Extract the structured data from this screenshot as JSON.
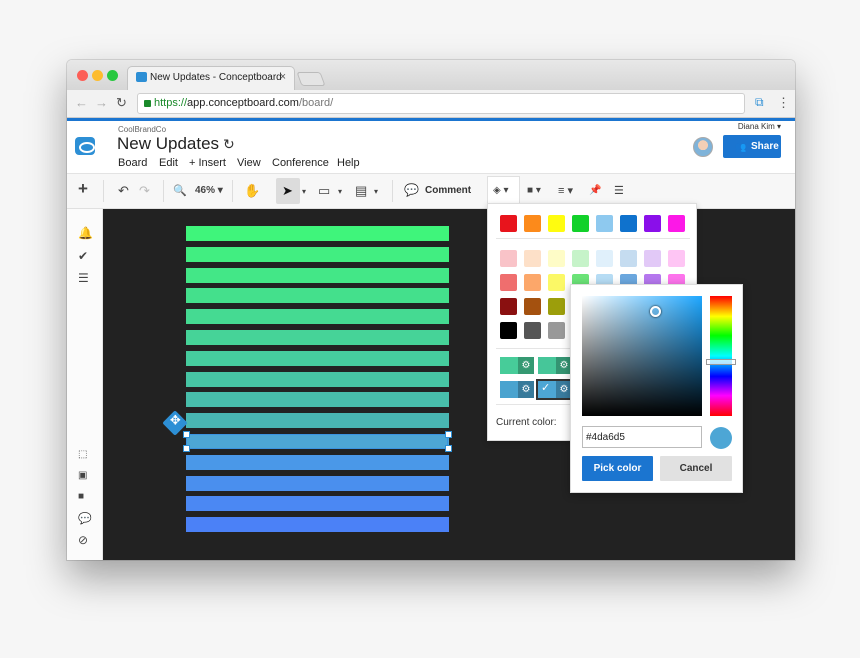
{
  "browser": {
    "tab_title": "New Updates - Conceptboard",
    "tab_close": "×",
    "url_scheme": "https://",
    "url_host": "app.conceptboard.com",
    "url_path": "/board/",
    "back": "←",
    "forward": "→",
    "reload": "↻",
    "more": "⋮"
  },
  "header": {
    "brand": "CoolBrandCo",
    "title": "New Updates",
    "sync_icon": "↻",
    "menu": [
      "Board",
      "Edit",
      "+ Insert",
      "View",
      "Conference",
      "Help"
    ],
    "user_name": "Diana Kim ▾",
    "share_label": "Share",
    "share_icon": "👥"
  },
  "toolbar": {
    "add": "+",
    "undo": "↶",
    "redo": "↷",
    "zoom_icon": "🔍",
    "zoom_value": "46% ▾",
    "hand": "✋",
    "pointer": "➤",
    "pointer_caret": "▾",
    "shape": "▭",
    "shape_caret": "▾",
    "note": "▤",
    "note_caret": "▾",
    "comment_icon": "💬",
    "comment_label": "Comment",
    "fill": "◈ ▾",
    "color": "■ ▾",
    "lines": "≡ ▾",
    "pin": "📌",
    "list": "☰"
  },
  "sidebar": {
    "icons": [
      "🔔",
      "✔",
      "☰",
      "⬚",
      "▣",
      "■",
      "💬",
      "⊘"
    ]
  },
  "canvas": {
    "bars": [
      "#3ff57b",
      "#41ee81",
      "#43e787",
      "#44e08c",
      "#45da92",
      "#46d398",
      "#46cc9e",
      "#47c5a4",
      "#48beab",
      "#49b6b2",
      "#4da6d5",
      "#4a98e8",
      "#4a8fee",
      "#4b88f3",
      "#4b81f7"
    ]
  },
  "palette": {
    "row1": [
      "#e8141c",
      "#fc8a1b",
      "#fffc0f",
      "#12d12a",
      "#8ec9ef",
      "#0f72cd",
      "#8a0fea",
      "#fc18e7"
    ],
    "grid": [
      [
        "#f9c3c8",
        "#fde0c8",
        "#fefcc7",
        "#c6f3c9",
        "#e0f0fb",
        "#c5dcf0",
        "#e2c9f7",
        "#fec5f4"
      ],
      [
        "#ef6e6e",
        "#fca76a",
        "#fbf866",
        "#6be377",
        "#b6dcf4",
        "#6ba7de",
        "#b577ee",
        "#fd73ec"
      ],
      [
        "#8a1010",
        "#a4510f",
        "#9c9e0b"
      ],
      [
        "#000000",
        "#555555",
        "#999999"
      ]
    ],
    "presets": [
      {
        "color": "#47cc99",
        "gear": "⚙",
        "check": ""
      },
      {
        "color": "#46c699",
        "gear": "⚙",
        "check": ""
      },
      {
        "color": "#4aa3cf",
        "gear": "⚙",
        "check": ""
      },
      {
        "color": "#4da6d5",
        "gear": "⚙",
        "check": "✓"
      }
    ],
    "current_label": "Current color:"
  },
  "picker": {
    "hex_value": "#4da6d5",
    "preview_color": "#4da6d5",
    "pick_label": "Pick color",
    "cancel_label": "Cancel"
  }
}
